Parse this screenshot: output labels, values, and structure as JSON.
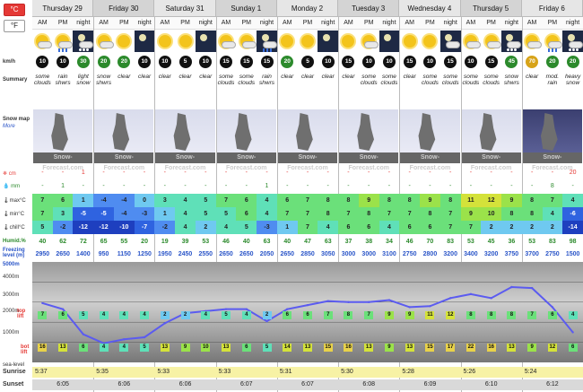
{
  "units": {
    "celsius": "°C",
    "fahrenheit": "°F"
  },
  "days": [
    "Thursday 29",
    "Friday 30",
    "Saturday 31",
    "Sunday 1",
    "Monday 2",
    "Tuesday 3",
    "Wednesday 4",
    "Thursday 5",
    "Friday 6"
  ],
  "segments": [
    "AM",
    "PM",
    "night"
  ],
  "labels": {
    "kmh": "km/h",
    "summary": "Summary",
    "snowmap": "Snow map",
    "more": "More",
    "snowcm": "cm",
    "rainmm": "mm",
    "max": "max°C",
    "min": "min°C",
    "chill": "chill°C",
    "humid": "Humid.%",
    "freezing": "Freezing level (m)",
    "sunrise": "Sunrise",
    "sunset": "Sunset",
    "sealevel": "sea-level",
    "toplift": "top lift",
    "botlift": "bot lift",
    "m5000": "5000m",
    "m4000": "4000m",
    "m3000": "3000m",
    "m2000": "2000m",
    "m1000": "1000m",
    "brand": "Snow-Forecast.com"
  },
  "icons": [
    "sun-cloud",
    "cloud-rain",
    "night-cloud-snow",
    "sun-cloud",
    "sun",
    "night-clear",
    "sun",
    "sun",
    "night-clear",
    "sun-cloud",
    "sun-cloud",
    "night-rain",
    "sun",
    "sun",
    "night-clear",
    "sun",
    "sun-cloud",
    "night-clear",
    "sun",
    "sun",
    "night-cloud",
    "sun-cloud",
    "sun-cloud",
    "night-snow",
    "sun-cloud",
    "cloud-rain",
    "night-snow"
  ],
  "wind": [
    "10",
    "10",
    "30",
    "20",
    "20",
    "10",
    "10",
    "5",
    "10",
    "15",
    "15",
    "15",
    "20",
    "5",
    "10",
    "15",
    "10",
    "10",
    "15",
    "10",
    "15",
    "10",
    "15",
    "45",
    "70",
    "20",
    "20"
  ],
  "summary": [
    "some clouds",
    "rain shwrs",
    "light snow",
    "snow shwrs",
    "clear",
    "clear",
    "clear",
    "clear",
    "clear",
    "some clouds",
    "some clouds",
    "rain shwrs",
    "clear",
    "clear",
    "clear",
    "clear",
    "some clouds",
    "some clouds",
    "clear",
    "some clouds",
    "some clouds",
    "some clouds",
    "some clouds",
    "snow shwrs",
    "clear",
    "mod. rain",
    "heavy snow"
  ],
  "snow": [
    "-",
    "-",
    "1",
    "-",
    "-",
    "-",
    "-",
    "-",
    "-",
    "-",
    "-",
    "-",
    "-",
    "-",
    "-",
    "-",
    "-",
    "-",
    "-",
    "-",
    "-",
    "-",
    "-",
    "-",
    "-",
    "-",
    "20"
  ],
  "rain": [
    "-",
    "1",
    "-",
    "-",
    "-",
    "-",
    "-",
    "-",
    "-",
    "-",
    "-",
    "1",
    "-",
    "-",
    "-",
    "-",
    "-",
    "-",
    "-",
    "-",
    "-",
    "-",
    "-",
    "-",
    "-",
    "8",
    "-"
  ],
  "maxT": [
    "7",
    "6",
    "1",
    "-4",
    "-4",
    "0",
    "3",
    "4",
    "5",
    "7",
    "6",
    "4",
    "6",
    "7",
    "8",
    "8",
    "9",
    "8",
    "8",
    "9",
    "8",
    "11",
    "12",
    "9",
    "8",
    "7",
    "4"
  ],
  "minT": [
    "7",
    "3",
    "-5",
    "-5",
    "-4",
    "-3",
    "1",
    "4",
    "5",
    "5",
    "6",
    "4",
    "7",
    "7",
    "8",
    "7",
    "8",
    "7",
    "7",
    "8",
    "7",
    "9",
    "10",
    "8",
    "8",
    "4",
    "-6"
  ],
  "chill": [
    "5",
    "-2",
    "-12",
    "-12",
    "-10",
    "-7",
    "-2",
    "4",
    "2",
    "4",
    "5",
    "-3",
    "1",
    "7",
    "4",
    "6",
    "6",
    "4",
    "6",
    "6",
    "7",
    "7",
    "2",
    "2",
    "2",
    "2",
    "-14"
  ],
  "humid": [
    "40",
    "62",
    "72",
    "65",
    "55",
    "20",
    "19",
    "39",
    "53",
    "46",
    "40",
    "63",
    "40",
    "47",
    "63",
    "37",
    "38",
    "34",
    "46",
    "70",
    "83",
    "53",
    "45",
    "36",
    "53",
    "83",
    "98"
  ],
  "freezing": [
    "2950",
    "2650",
    "1400",
    "950",
    "1150",
    "1250",
    "1950",
    "2450",
    "2550",
    "2650",
    "2650",
    "2050",
    "2650",
    "2850",
    "3050",
    "3000",
    "3000",
    "3100",
    "2750",
    "2800",
    "3200",
    "3400",
    "3200",
    "3750",
    "3700",
    "2750",
    "1500"
  ],
  "toplift": [
    "7",
    "6",
    "5",
    "4",
    "4",
    "4",
    "2",
    "2",
    "4",
    "5",
    "4",
    "2",
    "6",
    "6",
    "7",
    "8",
    "7",
    "9",
    "9",
    "11",
    "12",
    "8",
    "8",
    "8",
    "7",
    "6",
    "4"
  ],
  "botlift": [
    "16",
    "13",
    "6",
    "4",
    "4",
    "5",
    "13",
    "9",
    "10",
    "13",
    "6",
    "5",
    "14",
    "13",
    "15",
    "16",
    "13",
    "9",
    "13",
    "15",
    "17",
    "22",
    "16",
    "13",
    "9",
    "12",
    "6"
  ],
  "sunrise": [
    "5:37",
    "5:35",
    "5:33",
    "5:33",
    "5:31",
    "5:30",
    "5:28",
    "5:26",
    "5:24"
  ],
  "sunset": [
    "6:05",
    "6:06",
    "6:06",
    "6:07",
    "6:07",
    "6:08",
    "6:09",
    "6:10",
    "6:12"
  ],
  "colors": {
    "accent": "#e53935",
    "header": "#e6e6e6",
    "map": "#d9dcec"
  }
}
